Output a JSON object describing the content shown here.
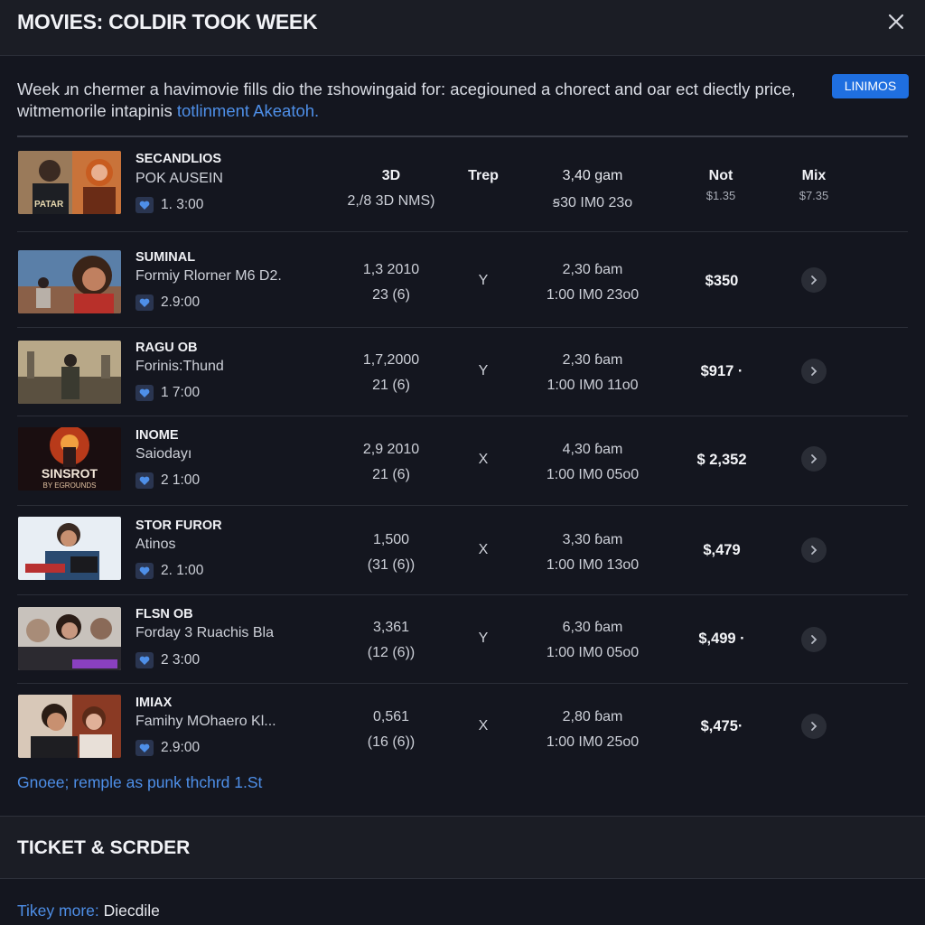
{
  "header": {
    "title": "MOVIES: COLDIR TOOK WEEK"
  },
  "intro": {
    "line1": "Week ɹn chermer a havimovie fills dio the ɪshowingaid for: acegiouned a chorect and oar ect diectly price,",
    "line2_text": "witmemorile intapinis ",
    "line2_link": "totlinment Akeatoh."
  },
  "badge": {
    "label": "LINIMOS"
  },
  "columns": {
    "c1": "3D",
    "c2": "Trep",
    "c3": "3,40 ɡam",
    "c4": "Not",
    "c5": "Mix"
  },
  "first_row": {
    "c1": "2,/8 3D NMS)",
    "c3": "ꞩ30 IM0 23o",
    "c4": "$1.35",
    "c5": "$7.35"
  },
  "movies": [
    {
      "title": "SECANDLIOS",
      "subtitle": "POK AUSEIN",
      "rating": "1. 3:00"
    },
    {
      "title": "SUMINAL",
      "subtitle": "Formiy Rlorner M6 D2.",
      "rating": "2.9:00",
      "c1a": "1,3 2010",
      "c1b": "23 (6)",
      "c2": "Y",
      "c3a": "2,30 ɓam",
      "c3b": "1:00 IM0 23o0",
      "price": "$350"
    },
    {
      "title": "RAGU OB",
      "subtitle": "Forinis:Thund",
      "rating": "1 7:00",
      "c1a": "1,7,2000",
      "c1b": "21 (6)",
      "c2": "Y",
      "c3a": "2,30 ɓam",
      "c3b": "1:00 IM0 11o0",
      "price": "$917 ·"
    },
    {
      "title": "INOME",
      "subtitle": "Saiodayı",
      "rating": "2 1:00",
      "c1a": "2,9 2010",
      "c1b": "21 (6)",
      "c2": "X",
      "c3a": "4,30 ɓam",
      "c3b": "1:00 IM0 05o0",
      "price": "$ 2,352"
    },
    {
      "title": "STOR FUROR",
      "subtitle": "Atinos",
      "rating": "2. 1:00",
      "c1a": "1,500",
      "c1b": "(31 (6))",
      "c2": "X",
      "c3a": "3,30 ɓam",
      "c3b": "1:00 IM0 13o0",
      "price": "$,479"
    },
    {
      "title": "FLSN OB",
      "subtitle": "Forday 3 Ruachis Bla",
      "rating": "2 3:00",
      "c1a": "3,361",
      "c1b": "(12 (6))",
      "c2": "Y",
      "c3a": "6,30 ɓam",
      "c3b": "1:00 IM0 05o0",
      "price": "$,499 ·"
    },
    {
      "title": "IMIAX",
      "subtitle": "Famihy MOhaero Kl...",
      "rating": "2.9:00",
      "c1a": "0,561",
      "c1b": "(16 (6))",
      "c2": "X",
      "c3a": "2,80 ɓam",
      "c3b": "1:00 IM0 25o0",
      "price": "$,475·"
    }
  ],
  "posters": {
    "p1_text": "PATAR",
    "p3_text": "",
    "p4_line1": "SINSROT",
    "p4_line2": "BY EGROUNDS"
  },
  "footer_link": "Gnoee; remple as punk thchrd 1.St",
  "section": {
    "title": "TICKET & SCRDER"
  },
  "bottom": {
    "link": "Tikey more:",
    "text": " Diecdile"
  },
  "colors": {
    "accent": "#1f6fe0",
    "link": "#4e8fe8",
    "background": "#14161f"
  }
}
